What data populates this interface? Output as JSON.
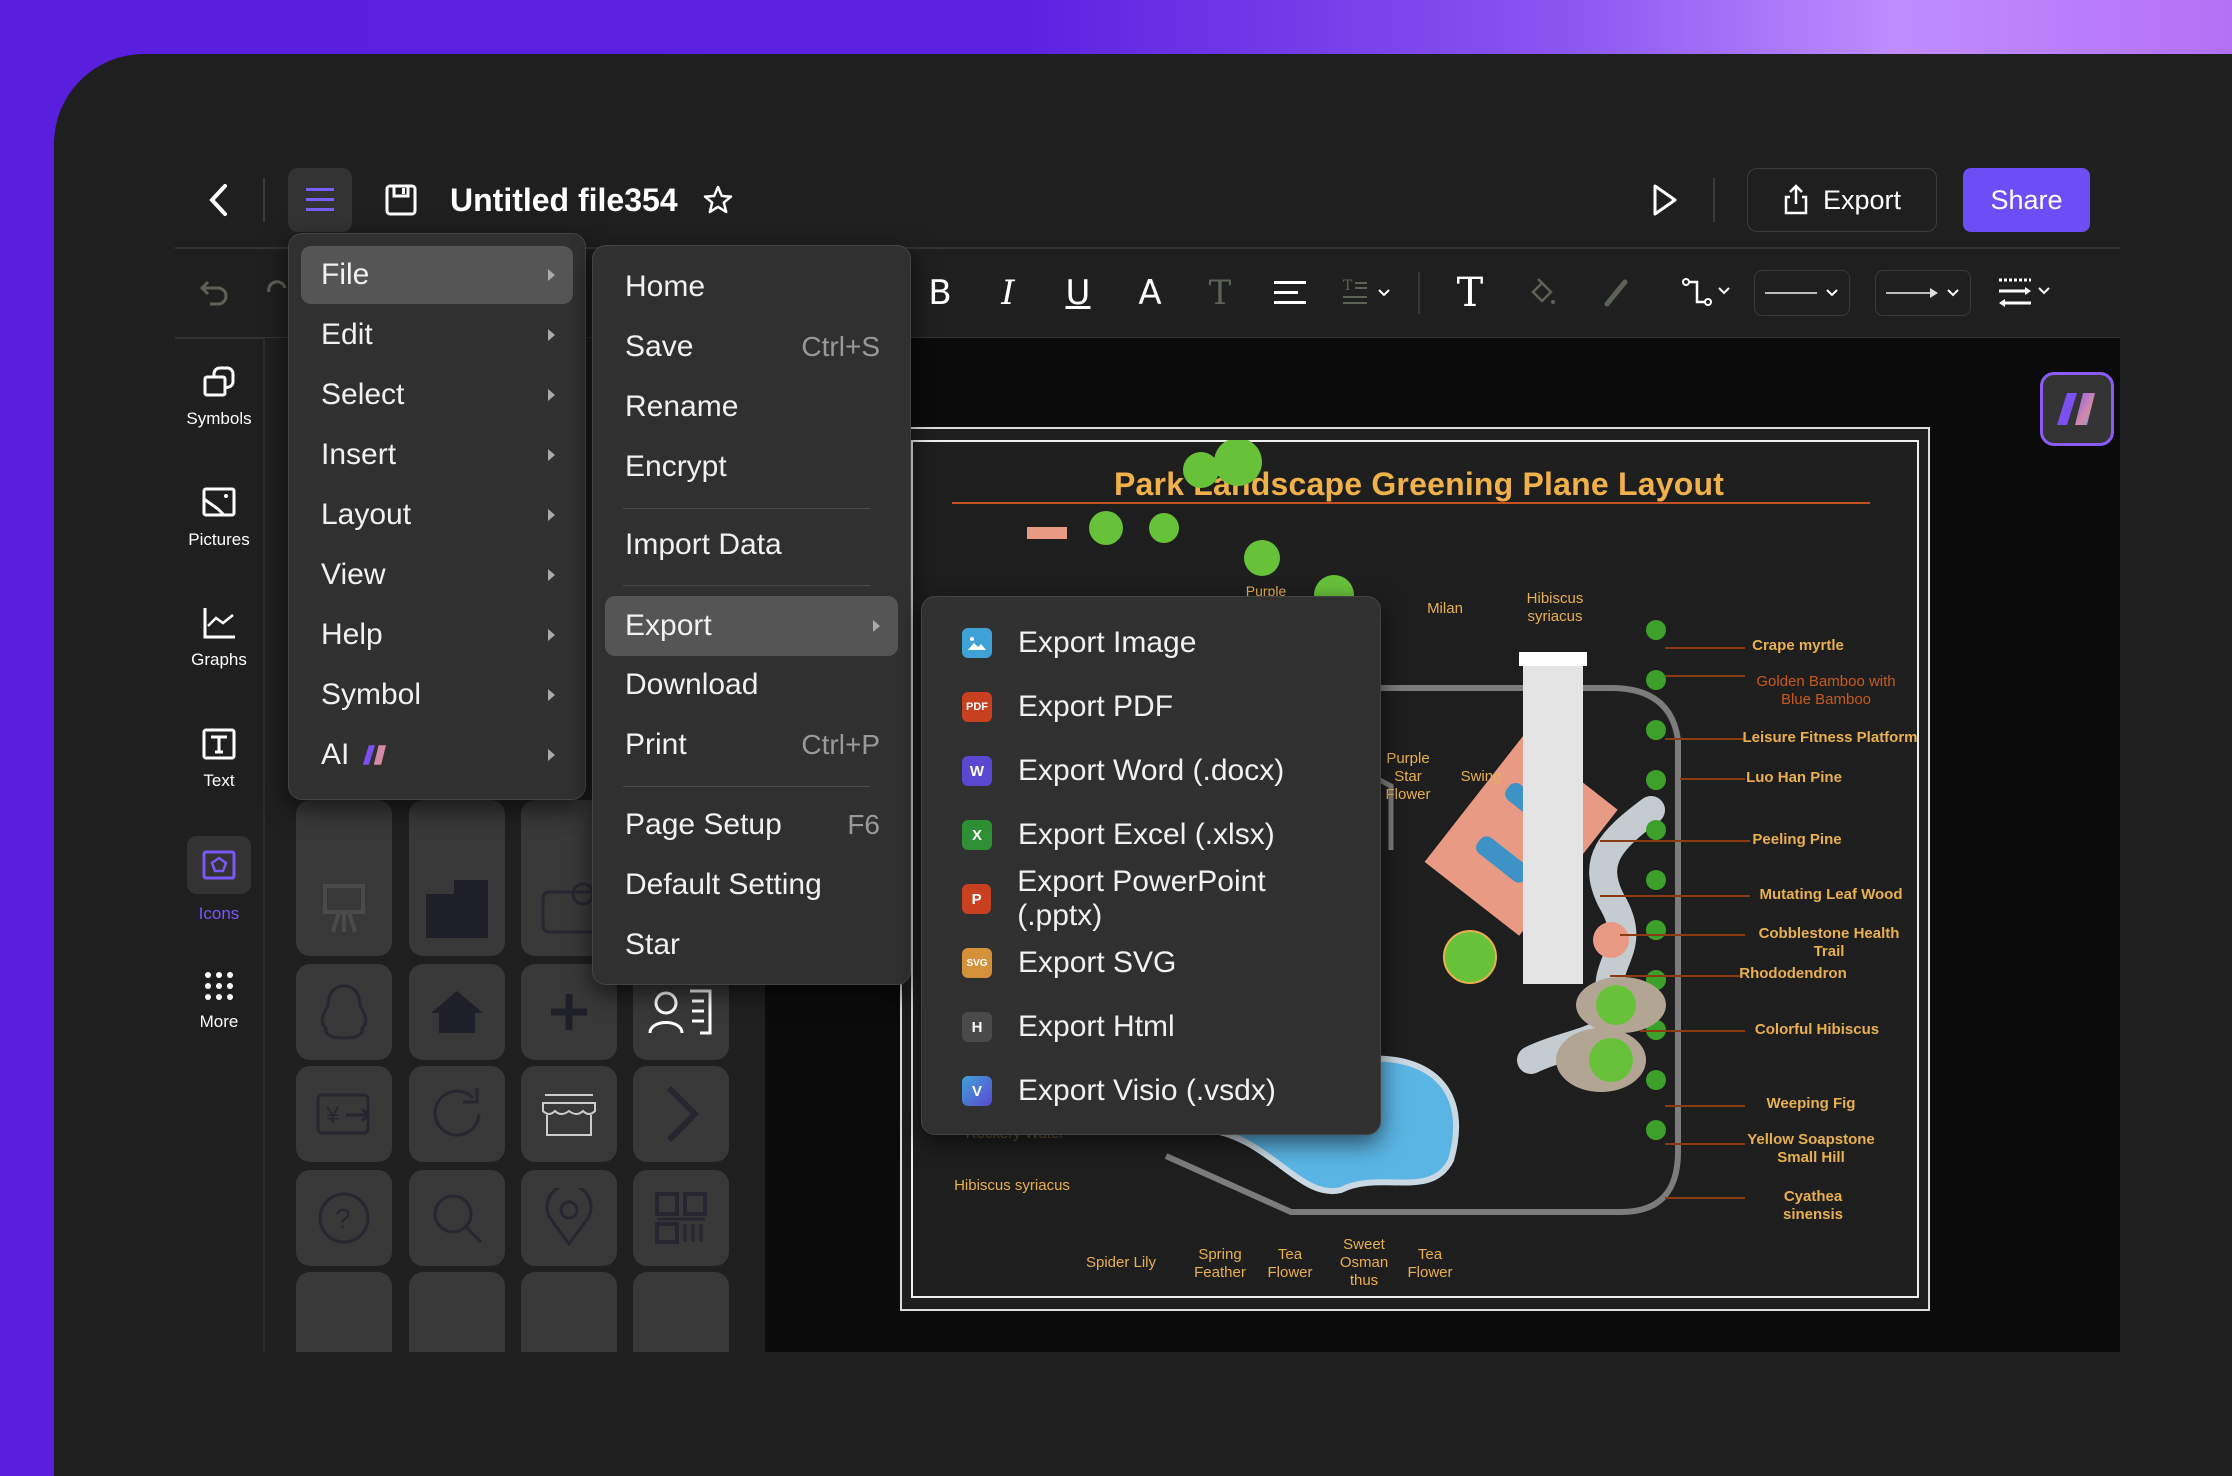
{
  "header": {
    "title": "Untitled file354",
    "export_label": "Export",
    "share_label": "Share",
    "accent_color": "#6d4ef6"
  },
  "toolbar": {
    "icons": [
      "undo-icon",
      "redo-icon",
      "bold-icon",
      "italic-icon",
      "underline-icon",
      "font-color-icon",
      "text-highlight-icon",
      "align-icon",
      "line-spacing-icon",
      "text-tool-icon",
      "fill-icon",
      "pen-icon",
      "connector-icon",
      "line-style-dropdown",
      "arrow-style-dropdown",
      "line-width-icon"
    ]
  },
  "sidebar": {
    "items": [
      {
        "label": "Symbols",
        "icon": "symbols-icon"
      },
      {
        "label": "Pictures",
        "icon": "pictures-icon"
      },
      {
        "label": "Graphs",
        "icon": "graphs-icon"
      },
      {
        "label": "Text",
        "icon": "text-icon"
      },
      {
        "label": "Icons",
        "icon": "icons-icon",
        "active": true
      },
      {
        "label": "More",
        "icon": "more-icon"
      }
    ]
  },
  "main_menu": {
    "items": [
      {
        "label": "File",
        "highlighted": true
      },
      {
        "label": "Edit"
      },
      {
        "label": "Select"
      },
      {
        "label": "Insert"
      },
      {
        "label": "Layout"
      },
      {
        "label": "View"
      },
      {
        "label": "Help"
      },
      {
        "label": "Symbol"
      },
      {
        "label": "AI"
      }
    ]
  },
  "file_menu": {
    "items": [
      {
        "label": "Home"
      },
      {
        "label": "Save",
        "shortcut": "Ctrl+S"
      },
      {
        "label": "Rename"
      },
      {
        "label": "Encrypt"
      },
      {
        "label": "Import Data"
      },
      {
        "label": "Export",
        "highlighted": true
      },
      {
        "label": "Download"
      },
      {
        "label": "Print",
        "shortcut": "Ctrl+P"
      },
      {
        "label": "Page Setup",
        "shortcut": "F6"
      },
      {
        "label": "Default Setting"
      },
      {
        "label": "Star"
      }
    ]
  },
  "export_menu": {
    "items": [
      {
        "label": "Export Image",
        "badge": "",
        "color": "#3fa2d6"
      },
      {
        "label": "Export PDF",
        "badge": "PDF",
        "color": "#c8401f"
      },
      {
        "label": "Export Word (.docx)",
        "badge": "W",
        "color": "#5a48d0"
      },
      {
        "label": "Export Excel (.xlsx)",
        "badge": "X",
        "color": "#2f8f34"
      },
      {
        "label": "Export PowerPoint (.pptx)",
        "badge": "P",
        "color": "#c8401f"
      },
      {
        "label": "Export SVG",
        "badge": "SVG",
        "color": "#d4913a"
      },
      {
        "label": "Export Html",
        "badge": "H",
        "color": "#4a4a4a"
      },
      {
        "label": "Export Visio (.vsdx)",
        "badge": "V",
        "color": "#3f7fe0"
      }
    ]
  },
  "canvas": {
    "plan_title": "Park Landscape Greening Plane Layout",
    "top_labels": {
      "purple": "Purple",
      "milan": "Milan",
      "hibiscus_top": "Hibiscus syriacus",
      "purple_star_flower": "Purple Star Flower",
      "swing": "Swing"
    },
    "right_labels": [
      "Crape myrtle",
      "Golden Bamboo with Blue Bamboo",
      "Leisure Fitness Platform",
      "Luo Han Pine",
      "Peeling Pine",
      "Mutating Leaf Wood",
      "Cobblestone Health Trail",
      "Rhododendron",
      "Colorful Hibiscus",
      "Weeping Fig",
      "Yellow Soapstone Small Hill",
      "Cyathea sinensis"
    ],
    "bottom_labels": {
      "rockery": "Rockery Water",
      "hibiscus": "Hibiscus syriacus",
      "spider_lily": "Spider Lily",
      "spring_feather": "Spring Feather",
      "tea_flower_1": "Tea Flower",
      "sweet_osmanthus": "Sweet Osman thus",
      "tea_flower_2": "Tea Flower"
    }
  }
}
